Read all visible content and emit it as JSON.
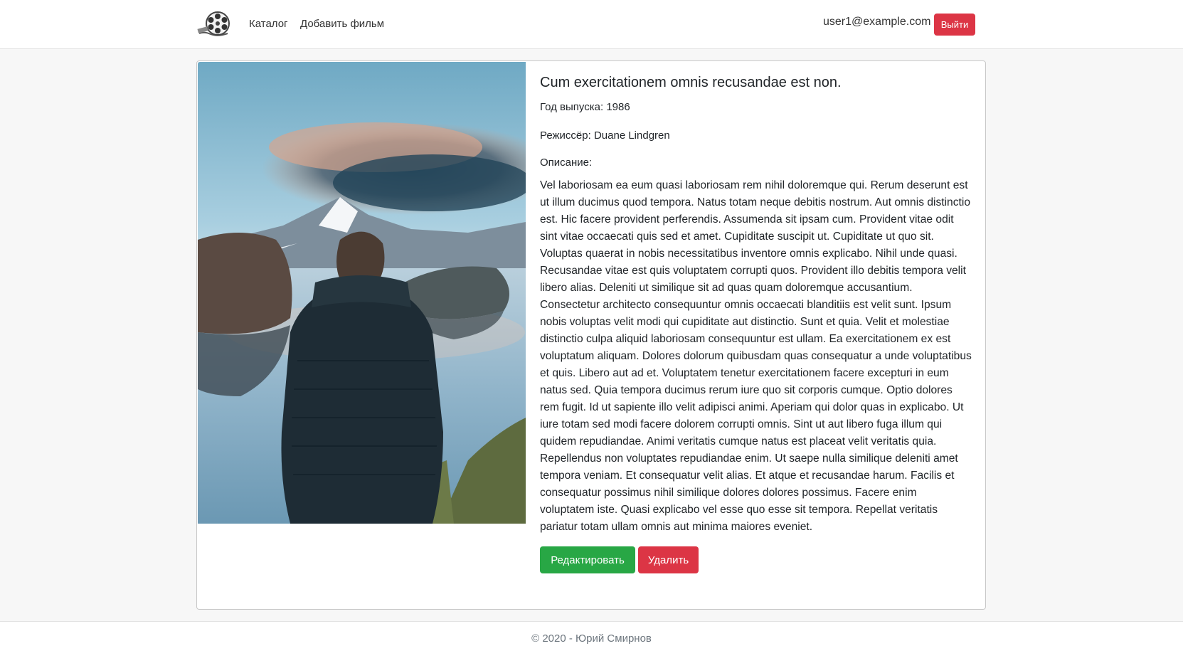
{
  "nav": {
    "logo": "film-reel-icon",
    "links": [
      "Каталог",
      "Добавить фильм"
    ],
    "user_email": "user1@example.com",
    "logout_label": "Выйти"
  },
  "movie": {
    "title": "Cum exercitationem omnis recusandae est non.",
    "year_label": "Год выпуска:",
    "year": "1986",
    "director_label": "Режиссёр:",
    "director": "Duane Lindgren",
    "description_label": "Описание:",
    "description": "Vel laboriosam ea eum quasi laboriosam rem nihil doloremque qui. Rerum deserunt est ut illum ducimus quod tempora. Natus totam neque debitis nostrum. Aut omnis distinctio est. Hic facere provident perferendis. Assumenda sit ipsam cum. Provident vitae odit sint vitae occaecati quis sed et amet. Cupiditate suscipit ut. Cupiditate ut quo sit. Voluptas quaerat in nobis necessitatibus inventore omnis explicabo. Nihil unde quasi. Recusandae vitae est quis voluptatem corrupti quos. Provident illo debitis tempora velit libero alias. Deleniti ut similique sit ad quas quam doloremque accusantium. Consectetur architecto consequuntur omnis occaecati blanditiis est velit sunt. Ipsum nobis voluptas velit modi qui cupiditate aut distinctio. Sunt et quia. Velit et molestiae distinctio culpa aliquid laboriosam consequuntur est ullam. Ea exercitationem ex est voluptatum aliquam. Dolores dolorum quibusdam quas consequatur a unde voluptatibus et quis. Libero aut ad et. Voluptatem tenetur exercitationem facere excepturi in eum natus sed. Quia tempora ducimus rerum iure quo sit corporis cumque. Optio dolores rem fugit. Id ut sapiente illo velit adipisci animi. Aperiam qui dolor quas in explicabo. Ut iure totam sed modi facere dolorem corrupti omnis. Sint ut aut libero fuga illum qui quidem repudiandae. Animi veritatis cumque natus est placeat velit veritatis quia. Repellendus non voluptates repudiandae enim. Ut saepe nulla similique deleniti amet tempora veniam. Et consequatur velit alias. Et atque et recusandae harum. Facilis et consequatur possimus nihil similique dolores dolores possimus. Facere enim voluptatem iste. Quasi explicabo vel esse quo esse sit tempora. Repellat veritatis pariatur totam ullam omnis aut minima maiores eveniet.",
    "edit_label": "Редактировать",
    "delete_label": "Удалить"
  },
  "footer": {
    "copyright": "© 2020 - Юрий Смирнов"
  },
  "colors": {
    "danger": "#dc3545",
    "success": "#28a745"
  }
}
